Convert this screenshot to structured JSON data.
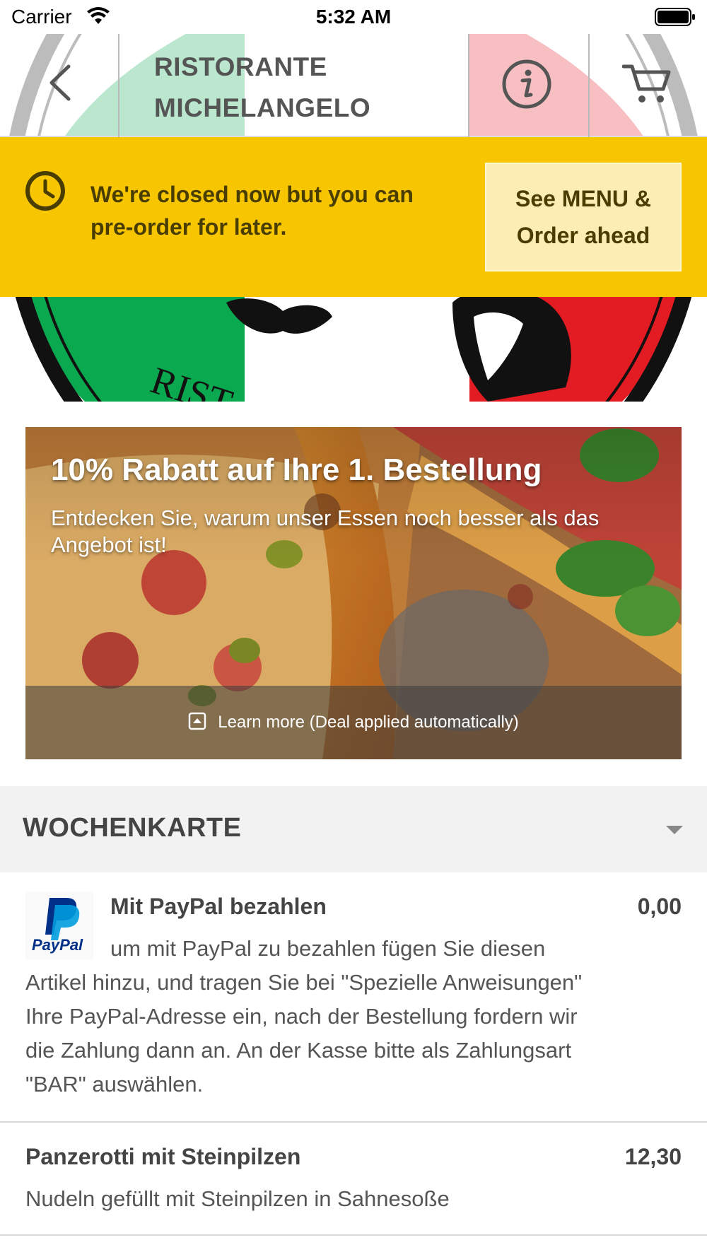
{
  "status_bar": {
    "carrier": "Carrier",
    "time": "5:32 AM"
  },
  "header": {
    "title_line1": "RISTORANTE",
    "title_line2": "MICHELANGELO",
    "icons": [
      "chevron-left-icon",
      "info-icon",
      "cart-icon"
    ]
  },
  "closed_banner": {
    "message": "We're closed now but you can pre-order for later.",
    "button_label": "See MENU & Order ahead",
    "color": "#f7c600"
  },
  "promo": {
    "title": "10% Rabatt auf Ihre 1. Bestellung",
    "subtitle": "Entdecken Sie, warum unser Essen noch besser als das Angebot ist!",
    "footer_label": "Learn more (Deal applied automatically)"
  },
  "menu_section": {
    "title": "WOCHENKARTE"
  },
  "menu_items": [
    {
      "name": "Mit PayPal bezahlen",
      "price": "0,00",
      "logo_text": "PayPal",
      "description": "um mit PayPal zu bezahlen fügen Sie diesen Artikel hinzu, und tragen Sie bei \"Spezielle Anweisungen\" Ihre PayPal-Adresse ein, nach der Bestellung fordern wir die Zahlung dann an. An der Kasse bitte als Zahlungsart \"BAR\" auswählen."
    },
    {
      "name": "Panzerotti mit Steinpilzen",
      "price": "12,30",
      "description": "Nudeln gefüllt mit Steinpilzen in Sahnesoße"
    }
  ]
}
